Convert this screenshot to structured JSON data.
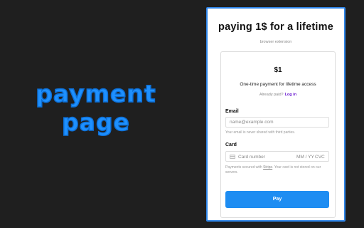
{
  "promo": {
    "line1": "payment",
    "line2": "page"
  },
  "panel": {
    "title": "paying 1$ for a lifetime",
    "subtitle": "browser extension"
  },
  "checkout": {
    "price": "$1",
    "description": "One-time payment for lifetime access",
    "already_paid": "Already paid?",
    "login_link": "Log in",
    "email_label": "Email",
    "email_placeholder": "name@example.com",
    "email_value": "",
    "email_hint": "Your email is never shared with third parties.",
    "card_label": "Card",
    "card_number_placeholder": "Card number",
    "card_expiry_placeholder": "MM / YY",
    "card_cvc_placeholder": "CVC",
    "card_icon": "credit-card-icon",
    "stripe_note_prefix": "Payments secured with",
    "stripe_link": "Stripe",
    "stripe_note_suffix": ". Your card is not stored on our servers.",
    "pay_button": "Pay"
  },
  "colors": {
    "background": "#1f1f1f",
    "promo_text": "#1e90ff",
    "panel_border": "#2f86ea",
    "pay_button": "#1e8df2",
    "login_link": "#6a1bd1"
  }
}
